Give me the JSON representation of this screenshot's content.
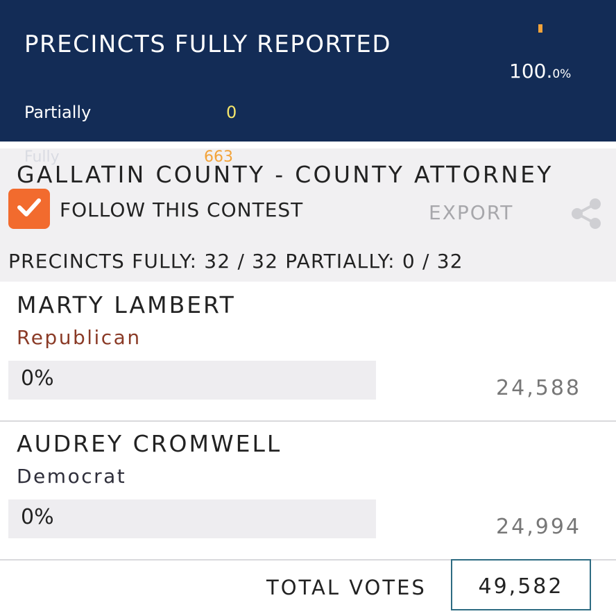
{
  "header": {
    "title": "PRECINCTS FULLY REPORTED",
    "percent_main": "100.",
    "percent_small": "0%",
    "partially_label": "Partially",
    "partially_value": "0",
    "fully_label": "Fully",
    "fully_value": "663"
  },
  "contest": {
    "title": "GALLATIN COUNTY - COUNTY ATTORNEY",
    "follow_label": "FOLLOW THIS CONTEST",
    "follow_checked": true,
    "export_label": "EXPORT",
    "precincts_line": "PRECINCTS FULLY: 32 / 32 PARTIALLY: 0 / 32"
  },
  "candidates": [
    {
      "name": "MARTY LAMBERT",
      "party": "Republican",
      "party_color": "#8a3a26",
      "bar_label": "0%",
      "bar_fill": 0,
      "votes": "24,588"
    },
    {
      "name": "AUDREY CROMWELL",
      "party": "Democrat",
      "party_color": "#2e2e3a",
      "bar_label": "0%",
      "bar_fill": 0,
      "votes": "24,994"
    }
  ],
  "total": {
    "label": "TOTAL VOTES",
    "value": "49,582"
  },
  "colors": {
    "header_bg": "#132c56",
    "accent_orange": "#f26b2e",
    "fully_value": "#f2a33a",
    "partially_value": "#f5e66b"
  },
  "icons": {
    "checkbox": "check-icon",
    "share": "share-icon"
  }
}
